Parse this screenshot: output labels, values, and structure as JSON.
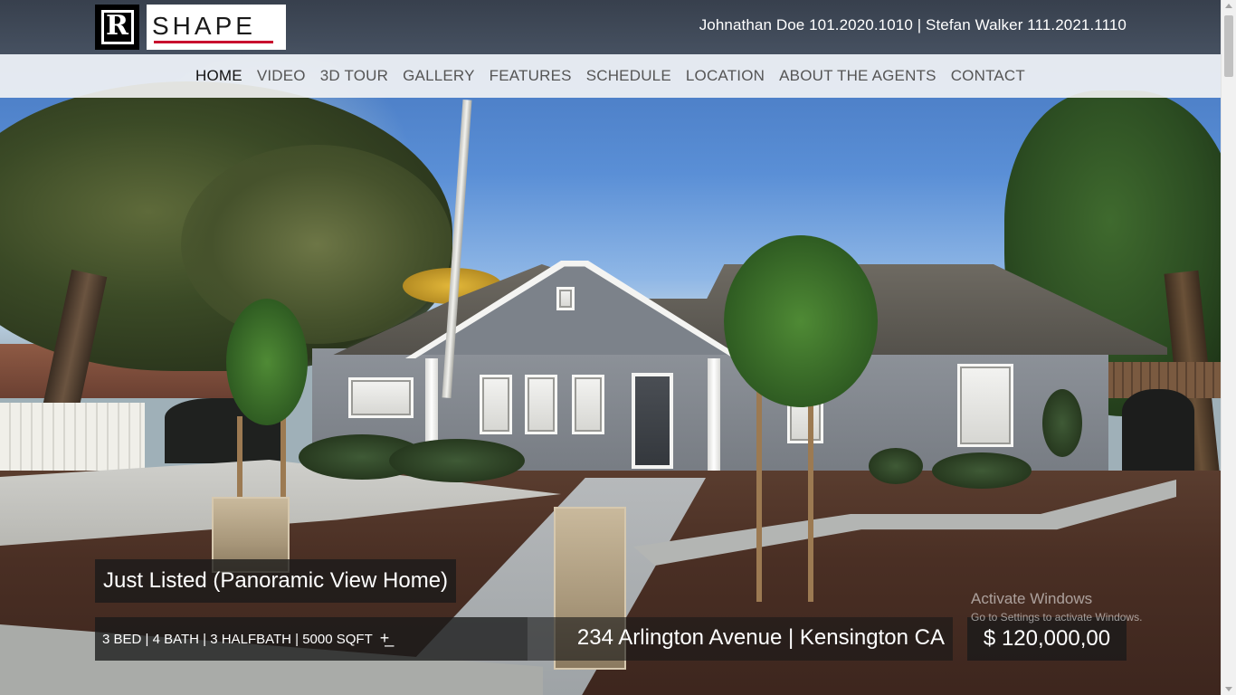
{
  "header": {
    "logo_letter": "R",
    "logo_wordmark": "SHAPE",
    "agents_contact": "Johnathan Doe 101.2020.1010 | Stefan Walker 111.2021.1110"
  },
  "nav": {
    "items": [
      {
        "label": "HOME",
        "active": true
      },
      {
        "label": "VIDEO"
      },
      {
        "label": "3D TOUR"
      },
      {
        "label": "GALLERY"
      },
      {
        "label": "FEATURES"
      },
      {
        "label": "SCHEDULE"
      },
      {
        "label": "LOCATION"
      },
      {
        "label": "ABOUT THE AGENTS"
      },
      {
        "label": "CONTACT"
      }
    ]
  },
  "listing": {
    "headline": "Just Listed (Panoramic View Home)",
    "specs": "3 BED | 4 BATH | 3 HALFBATH | 5000 SQFT",
    "more_icon": "plus-icon",
    "address": "234 Arlington Avenue | Kensington CA",
    "price": "$ 120,000,00"
  },
  "os_watermark": {
    "line1": "Activate Windows",
    "line2": "Go to Settings to activate Windows."
  },
  "colors": {
    "brand_red": "#c8102e",
    "overlay_bg": "#191919",
    "nav_bg": "#f5f5f5"
  }
}
